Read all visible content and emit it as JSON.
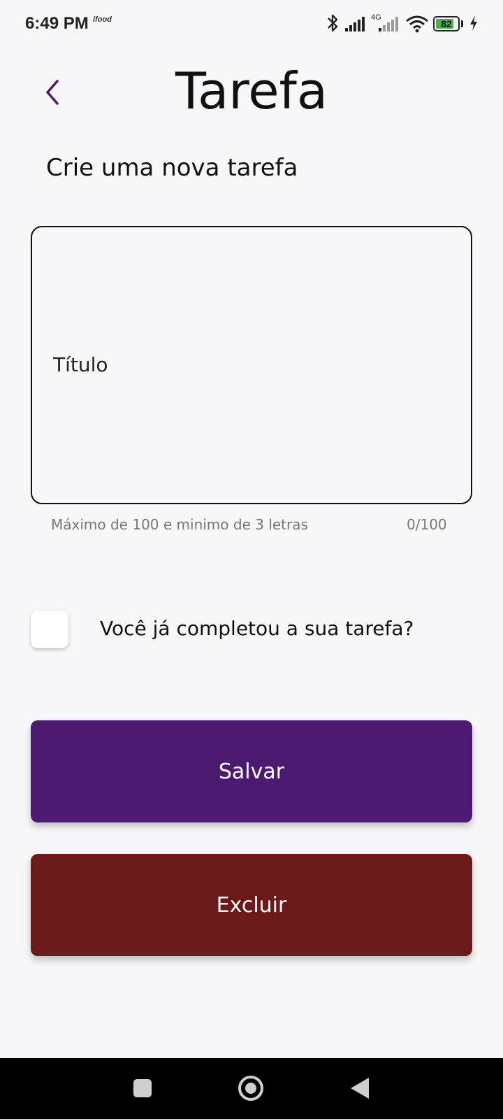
{
  "status_bar": {
    "time": "6:49 PM",
    "notification_app": "ifood",
    "battery_level": "82",
    "battery_fraction": 0.82,
    "battery_color": "#4caf50",
    "network_label": "4G"
  },
  "header": {
    "title": "Tarefa"
  },
  "form": {
    "subtitle": "Crie uma nova tarefa",
    "title_field_label": "Título",
    "helper_text": "Máximo de 100 e minimo de 3 letras",
    "counter": "0/100",
    "checkbox_label": "Você já completou a sua tarefa?",
    "checkbox_checked": false
  },
  "actions": {
    "save_label": "Salvar",
    "save_color": "#4b1b72",
    "delete_label": "Excluir",
    "delete_color": "#6b1a1a"
  },
  "colors": {
    "accent": "#4b1b72",
    "background": "#f7f7f9"
  }
}
